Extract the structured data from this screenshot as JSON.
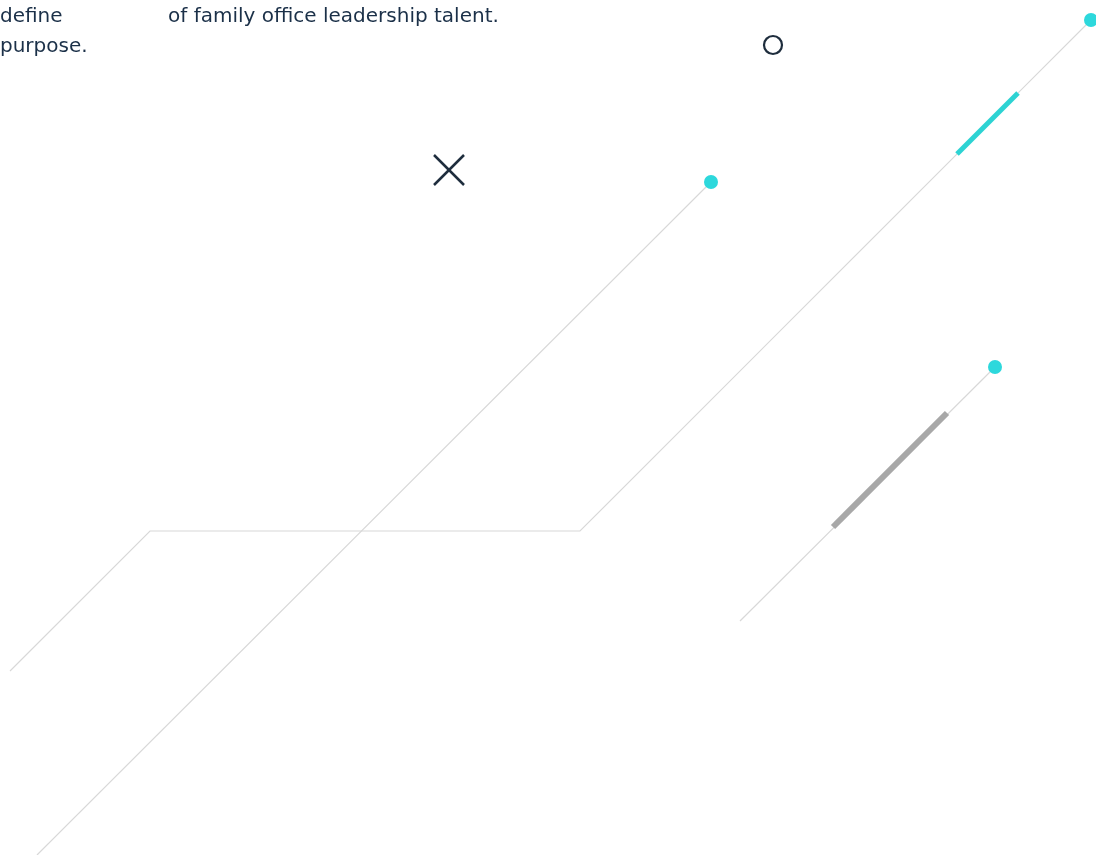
{
  "text_columns": [
    {
      "lines": [
        "define",
        "purpose."
      ]
    },
    {
      "lines": [
        "of family office leadership talent."
      ]
    }
  ]
}
